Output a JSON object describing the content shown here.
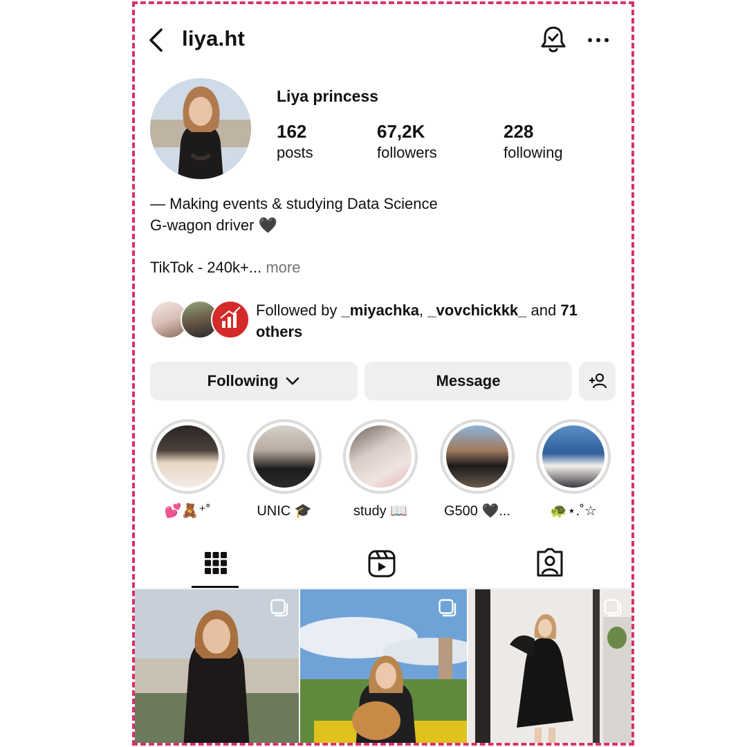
{
  "header": {
    "username": "liya.ht"
  },
  "profile": {
    "display_name": "Liya princess",
    "stats": [
      {
        "value": "162",
        "label": "posts"
      },
      {
        "value": "67,2K",
        "label": "followers"
      },
      {
        "value": "228",
        "label": "following"
      }
    ],
    "bio_line1": "— Making events & studying Data Science",
    "bio_line2": "G-wagon driver 🖤",
    "bio_line3": "TikTok - 240k+...",
    "bio_more": "more",
    "followed_by": {
      "prefix": "Followed by",
      "user1": "_miyachka",
      "separator": ",",
      "user2": "_vovchickkk_",
      "and_text": "and",
      "others_count": "71",
      "others_word": "others"
    }
  },
  "buttons": {
    "following": "Following",
    "message": "Message"
  },
  "highlights": [
    {
      "caption": "💕🧸⁺˚"
    },
    {
      "caption": "UNIC 🎓"
    },
    {
      "caption": "study 📖"
    },
    {
      "caption": "G500 🖤..."
    },
    {
      "caption": "🐢⋆.˚☆"
    }
  ],
  "tabs": {
    "active": "grid"
  },
  "colors": {
    "accent_frame": "#d6336c",
    "button_bg": "#efefef",
    "muted_text": "#737373"
  }
}
